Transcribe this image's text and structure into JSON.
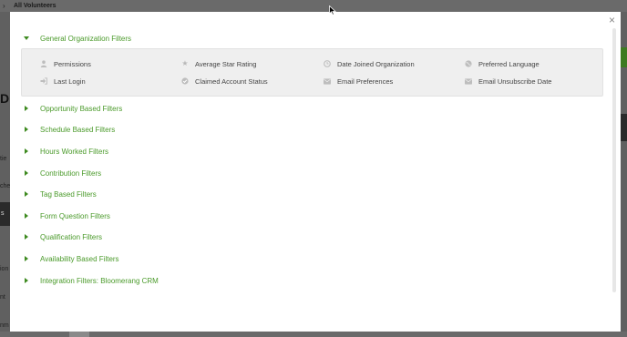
{
  "background": {
    "header_title": "All Volunteers",
    "fragments": [
      "D",
      "tie",
      "che",
      "s",
      "ion",
      "nt",
      "nm"
    ]
  },
  "modal": {
    "close_glyph": "×",
    "expanded_section": {
      "label": "General Organization Filters",
      "filters": [
        {
          "label": "Permissions",
          "icon": "person-icon"
        },
        {
          "label": "Average Star Rating",
          "icon": "star-icon"
        },
        {
          "label": "Date Joined Organization",
          "icon": "clock-icon"
        },
        {
          "label": "Preferred Language",
          "icon": "globe-icon"
        },
        {
          "label": "Last Login",
          "icon": "sign-in-icon"
        },
        {
          "label": "Claimed Account Status",
          "icon": "check-circle-icon"
        },
        {
          "label": "Email Preferences",
          "icon": "envelope-icon"
        },
        {
          "label": "Email Unsubscribe Date",
          "icon": "envelope-icon"
        }
      ]
    },
    "collapsed_sections": [
      "Opportunity Based Filters",
      "Schedule Based Filters",
      "Hours Worked Filters",
      "Contribution Filters",
      "Tag Based Filters",
      "Form Question Filters",
      "Qualification Filters",
      "Availability Based Filters",
      "Integration Filters: Bloomerang CRM"
    ]
  },
  "colors": {
    "accent_green": "#4a9a2a",
    "overlay": "#5f5f5f"
  }
}
